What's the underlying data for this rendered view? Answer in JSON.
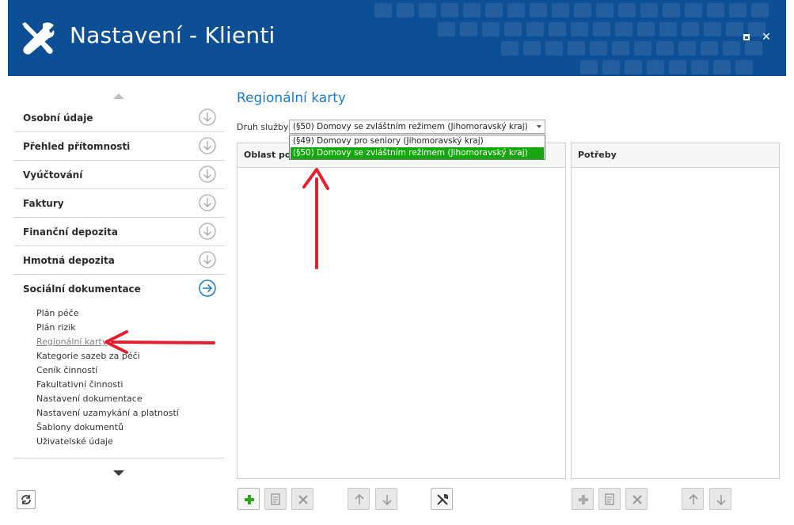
{
  "window": {
    "title": "Nastavení - Klienti",
    "colors": {
      "header_bg": "#0d4f95",
      "accent": "#1e7ac0",
      "selected_option": "#15a80d",
      "annotation": "#e2202f"
    }
  },
  "sidebar": {
    "items": [
      {
        "label": "Osobní údaje",
        "icon": "arrow-down-circle-icon"
      },
      {
        "label": "Přehled přítomnosti",
        "icon": "arrow-down-circle-icon"
      },
      {
        "label": "Vyúčtování",
        "icon": "arrow-down-circle-icon"
      },
      {
        "label": "Faktury",
        "icon": "arrow-down-circle-icon"
      },
      {
        "label": "Finanční depozita",
        "icon": "arrow-down-circle-icon"
      },
      {
        "label": "Hmotná depozita",
        "icon": "arrow-down-circle-icon"
      },
      {
        "label": "Sociální dokumentace",
        "icon": "arrow-right-circle-icon"
      }
    ],
    "subitems": [
      "Plán péče",
      "Plán rizik",
      "Regionální karty",
      "Kategorie sazeb za péči",
      "Ceník činností",
      "Fakultativní činnosti",
      "Nastavení dokumentace",
      "Nastavení uzamykání a platností",
      "Šablony dokumentů",
      "Uživatelské údaje"
    ],
    "active_subitem": "Regionální karty"
  },
  "main": {
    "title": "Regionální karty",
    "filter_label": "Druh služby:",
    "combo_value": "(§50) Domovy se zvláštním režimem (Jihomoravský kraj)",
    "dropdown_options": [
      "(§49) Domovy pro seniory (Jihomoravský kraj)",
      "(§50) Domovy se zvláštním režimem (Jihomoravský kraj)"
    ],
    "selected_option": "(§50) Domovy se zvláštním režimem (Jihomoravský kraj)",
    "left_panel_header": "Oblast pot",
    "right_panel_header": "Potřeby"
  }
}
